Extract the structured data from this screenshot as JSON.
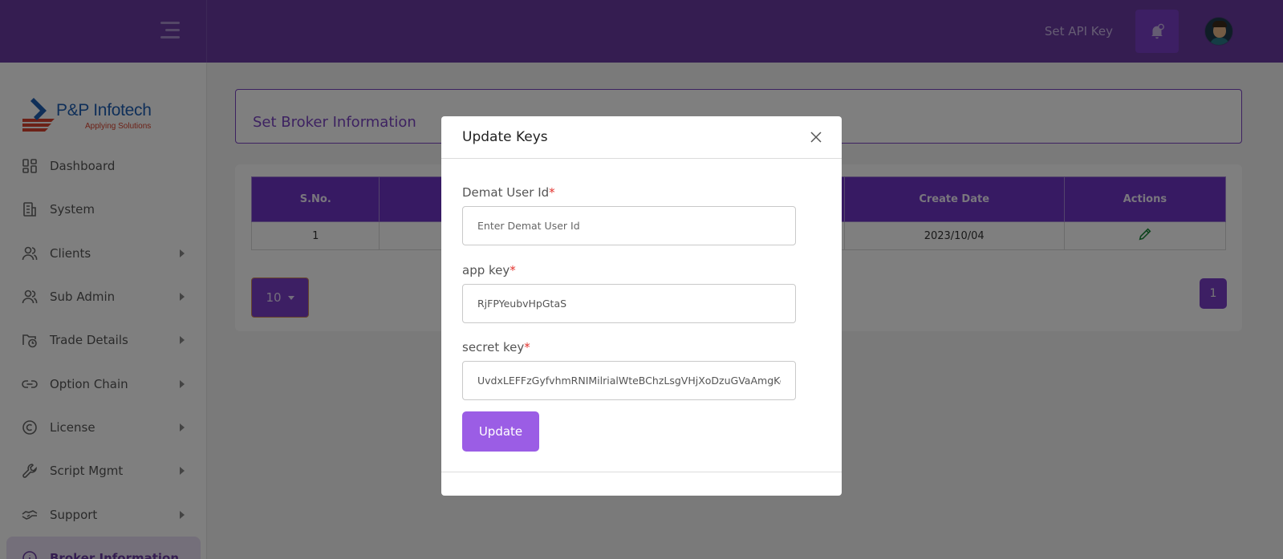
{
  "header": {
    "set_api_key": "Set API Key",
    "bell_icon": "bell-icon",
    "menu_icon": "hamburger-icon"
  },
  "logo": {
    "name": "P&P Infotech",
    "tagline": "Applying Solutions"
  },
  "sidebar": {
    "items": [
      {
        "label": "Dashboard",
        "icon": "dashboard-grid-icon",
        "has_arrow": false
      },
      {
        "label": "System",
        "icon": "building-icon",
        "has_arrow": false
      },
      {
        "label": "Clients",
        "icon": "users-icon",
        "has_arrow": true
      },
      {
        "label": "Sub Admin",
        "icon": "users-icon",
        "has_arrow": true
      },
      {
        "label": "Trade Details",
        "icon": "folder-clock-icon",
        "has_arrow": true
      },
      {
        "label": "Option Chain",
        "icon": "link-icon",
        "has_arrow": true
      },
      {
        "label": "License",
        "icon": "copyright-icon",
        "has_arrow": true
      },
      {
        "label": "Script Mgmt",
        "icon": "wrench-icon",
        "has_arrow": true
      },
      {
        "label": "Support",
        "icon": "handshake-icon",
        "has_arrow": true
      },
      {
        "label": "Broker Information",
        "icon": "info-icon",
        "has_arrow": false
      }
    ]
  },
  "main": {
    "page_title": "Set Broker Information",
    "table": {
      "columns": [
        "S.No.",
        "",
        "",
        "",
        "Create Date",
        "Actions"
      ],
      "rows": [
        {
          "sno": "1",
          "create_date": "2023/10/04",
          "action_icon": "pencil-icon"
        }
      ]
    },
    "page_size": "10",
    "current_page": "1"
  },
  "modal": {
    "title": "Update Keys",
    "fields": [
      {
        "label": "Demat User Id",
        "required": "*",
        "value": "",
        "placeholder": "Enter Demat User Id"
      },
      {
        "label": "app key",
        "required": "*",
        "value": "RjFPYeubvHpGtaS",
        "placeholder": ""
      },
      {
        "label": "secret key",
        "required": "*",
        "value": "UvdxLEFFzGyfvhmRNIMilrialWteBChzLsgVHjXoDzuGVaAmgKeYn",
        "placeholder": ""
      }
    ],
    "submit_label": "Update"
  },
  "colors": {
    "brand_purple": "#6a3ba3",
    "accent_purple": "#7b3ec8",
    "button_purple": "#9b5de5",
    "required_red": "#e3342f"
  }
}
